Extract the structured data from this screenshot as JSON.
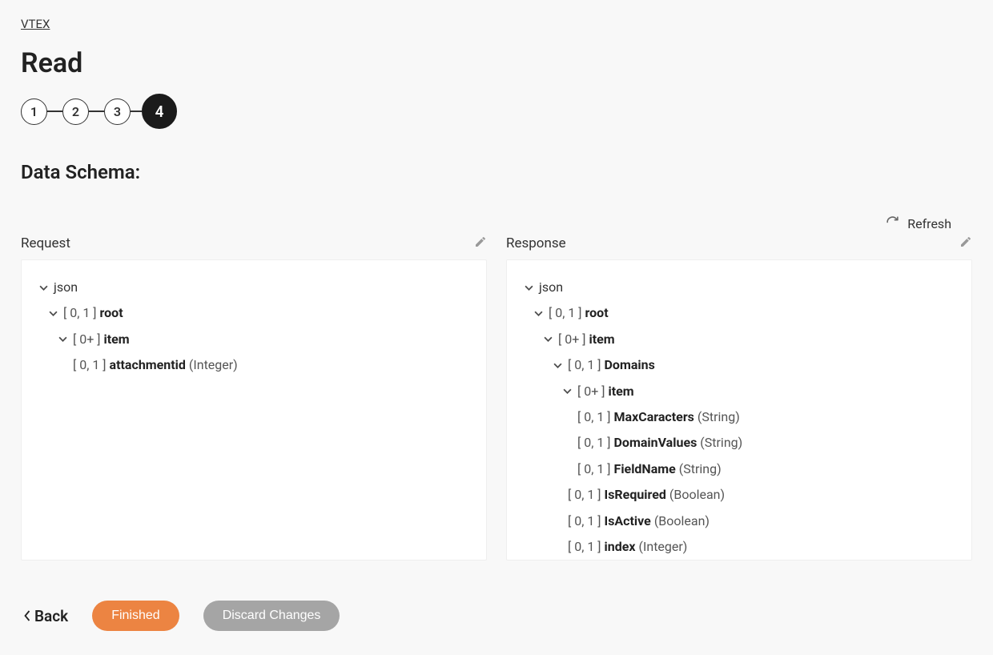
{
  "breadcrumb": {
    "label": "VTEX"
  },
  "title": "Read",
  "stepper": {
    "steps": [
      "1",
      "2",
      "3",
      "4"
    ],
    "activeIndex": 3
  },
  "sectionHeading": "Data Schema:",
  "refresh": {
    "label": "Refresh"
  },
  "request": {
    "title": "Request",
    "tree": {
      "json": "json",
      "root": {
        "card": "[ 0, 1 ]",
        "name": "root"
      },
      "item": {
        "card": "[ 0+ ]",
        "name": "item"
      },
      "attachmentid": {
        "card": "[ 0, 1 ]",
        "name": "attachmentid",
        "type": "(Integer)"
      }
    }
  },
  "response": {
    "title": "Response",
    "tree": {
      "json": "json",
      "root": {
        "card": "[ 0, 1 ]",
        "name": "root"
      },
      "item": {
        "card": "[ 0+ ]",
        "name": "item"
      },
      "domains": {
        "card": "[ 0, 1 ]",
        "name": "Domains"
      },
      "ditem": {
        "card": "[ 0+ ]",
        "name": "item"
      },
      "maxcar": {
        "card": "[ 0, 1 ]",
        "name": "MaxCaracters",
        "type": "(String)"
      },
      "domvals": {
        "card": "[ 0, 1 ]",
        "name": "DomainValues",
        "type": "(String)"
      },
      "fieldname": {
        "card": "[ 0, 1 ]",
        "name": "FieldName",
        "type": "(String)"
      },
      "isreq": {
        "card": "[ 0, 1 ]",
        "name": "IsRequired",
        "type": "(Boolean)"
      },
      "isactive": {
        "card": "[ 0, 1 ]",
        "name": "IsActive",
        "type": "(Boolean)"
      },
      "index": {
        "card": "[ 0, 1 ]",
        "name": "index",
        "type": "(Integer)"
      }
    }
  },
  "footer": {
    "back": "Back",
    "finished": "Finished",
    "discard": "Discard Changes"
  }
}
